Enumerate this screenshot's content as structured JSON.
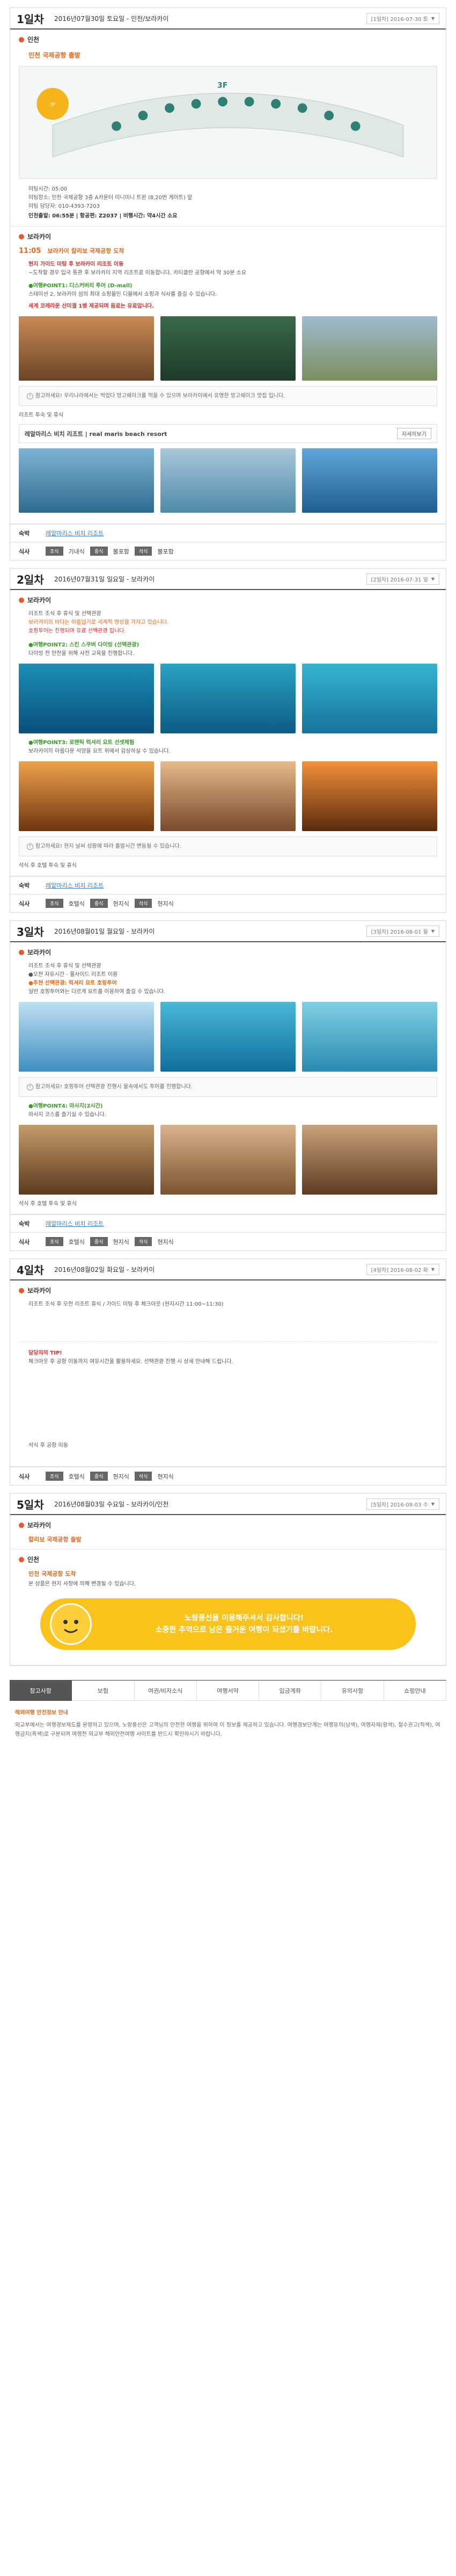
{
  "days": [
    {
      "no": "1일차",
      "date": "2016년07월30일 토요일 - 인천/보라카이",
      "box": "[1일차] 2016-07-30 토"
    },
    {
      "no": "2일차",
      "date": "2016년07월31일 일요일 - 보라카이",
      "box": "[2일차] 2016-07-31 일"
    },
    {
      "no": "3일차",
      "date": "2016년08월01일 월요일 - 보라카이",
      "box": "[3일차] 2016-08-01 월"
    },
    {
      "no": "4일차",
      "date": "2016년08월02일 화요일 - 보라카이",
      "box": "[4일차] 2016-08-02 화"
    },
    {
      "no": "5일차",
      "date": "2016년08월03일 수요일 - 보라카이/인천",
      "box": "[5일차] 2016-08-03 수"
    }
  ],
  "d1": {
    "loc1": "인천",
    "meet_title": "인천 국제공항 출발",
    "meet_lines": [
      "미팅시간: 05:00",
      "미팅장소: 인천 국제공항 3층 A카운터 미니미니 트윈 (8,20번 게이트) 앞",
      "미팅 담당자: 010-4393-7203"
    ],
    "flight": "인천출발: 06:55분 | 항공편: Z2037 | 비행시간: 약4시간 소요",
    "loc2": "보라카이",
    "time": "11:05",
    "arrive": "보라카이 칼리보 국제공항 도착",
    "guide": "현지 가이드 미팅 후 보라카이 리조트 이동",
    "desc": "~도착할 경우 입국 통관 후 보라카이 지역 리조트로 이동합니다. 카티클란 공항에서 약 30분 소요",
    "pt1": "●여행POINT1: 디스커버리 투어 (D-mall)",
    "pt1desc": "스테이션 2, 보라카이 섬의 최대 쇼핑몰인 디몰에서 쇼핑과 식사를 즐길 수 있습니다.",
    "pt1b": "세계 코레라운 산미겔 1병 제공되며 음료는 유료입니다.",
    "note": "참고하세요! 우리나라에서는 먹었다 망고쉐이크를 먹을 수 있으며 보라카이에서 유명한 망고쉐이크 맛집 입니다.",
    "hotel_label": "리조트 투숙 및 휴식",
    "hotel_name": "레알마리스 비치 리조트 | real maris beach resort",
    "more": "자세히보기",
    "stay": "레알마리스 비치 리조트",
    "meals": [
      "조식",
      "기내식",
      "중식",
      "불포함",
      "석식",
      "불포함"
    ]
  },
  "d2": {
    "loc": "보라카이",
    "lines": [
      "리조트 조식 후 휴식 및 선택관광",
      "보라카이의 바다는 아름답기로 세계적 명성을 가지고 있습니다.",
      "호핑투어는 진행되며 유료 선택관광 입니다."
    ],
    "pt2": "●여행POINT2: 스킨 스쿠버 다이빙 (선택관광)",
    "pt2desc": "다이빙 전 안전을 위해 사전 교육을 진행합니다.",
    "pt3": "●여행POINT3: 로맨틱 럭셔리 요트 선셋체험",
    "pt3desc": "보라카이의 아름다운 석양을 요트 위에서 감상하실 수 있습니다.",
    "note": "참고하세요! 현지 날씨 상황에 따라 출발시간 변동될 수 있습니다.",
    "end": "석식 후 호텔 투숙 및 휴식",
    "stay": "레알마리스 비치 리조트",
    "meals": [
      "조식",
      "호텔식",
      "중식",
      "현지식",
      "석식",
      "현지식"
    ]
  },
  "d3": {
    "loc": "보라카이",
    "lines": [
      "리조트 조식 후 휴식 및 선택관광",
      "●오전 자유시간 - 풀사이드 리조트 이용",
      "●추천 선택관광: 럭셔리 요트 호핑투어",
      "일반 호핑투어와는 다르게 요트를 이용하여 즐길 수 있습니다."
    ],
    "note": "참고하세요! 호핑투어 선택관광 진행시 물속에서도 투어를 진행합니다.",
    "pt4": "●여행POINT4: 마사지(2시간)",
    "pt4desc": "마사지 코스를 즐기실 수 있습니다.",
    "end": "석식 후 호텔 투숙 및 휴식",
    "stay": "레알마리스 비치 리조트",
    "meals": [
      "조식",
      "호텔식",
      "중식",
      "현지식",
      "석식",
      "현지식"
    ]
  },
  "d4": {
    "loc": "보라카이",
    "l1": "리조트 조식 후 오전 리조트 휴식 / 가이드 미팅 후 체크아웃 (현지시간 11:00~11:30)",
    "note_title": "담당자의 TIP!",
    "note": "체크아웃 후 공항 이동까지 여유시간을 활용하세요. 선택관광 진행 시 상세 안내해 드립니다.",
    "end": "석식 후 공항 이동",
    "meals": [
      "조식",
      "호텔식",
      "중식",
      "현지식",
      "석식",
      "현지식"
    ]
  },
  "d5": {
    "loc1": "보라카이",
    "depart": "칼리보 국제공항 출발",
    "loc2": "인천",
    "arrive": "인천 국제공항 도착",
    "line": "본 상품은 현지 사정에 의해 변경될 수 있습니다."
  },
  "banner": {
    "l1": "노랑풍선을 이용해주셔서 감사합니다!",
    "l2": "소중한 추억으로 남은 즐거운 여행이 되셨기를 바랍니다."
  },
  "tabs": [
    "참고사항",
    "보험",
    "여권/비자소식",
    "여행서약",
    "입금계좌",
    "유의사항",
    "쇼핑안내"
  ],
  "notice_title": "해외여행 안전정보 안내",
  "notice": "외교부에서는 여행경보제도를 운영하고 있으며, 노랑풍선은 고객님의 안전한 여행을 위하여 이 정보를 제공하고 있습니다. 여행경보단계는 여행유의(남색), 여행자제(황색), 철수권고(적색), 여행금지(흑색)로 구분되며 여행전 외교부 해외안전여행 사이트를 반드시 확인하시기 바랍니다."
}
